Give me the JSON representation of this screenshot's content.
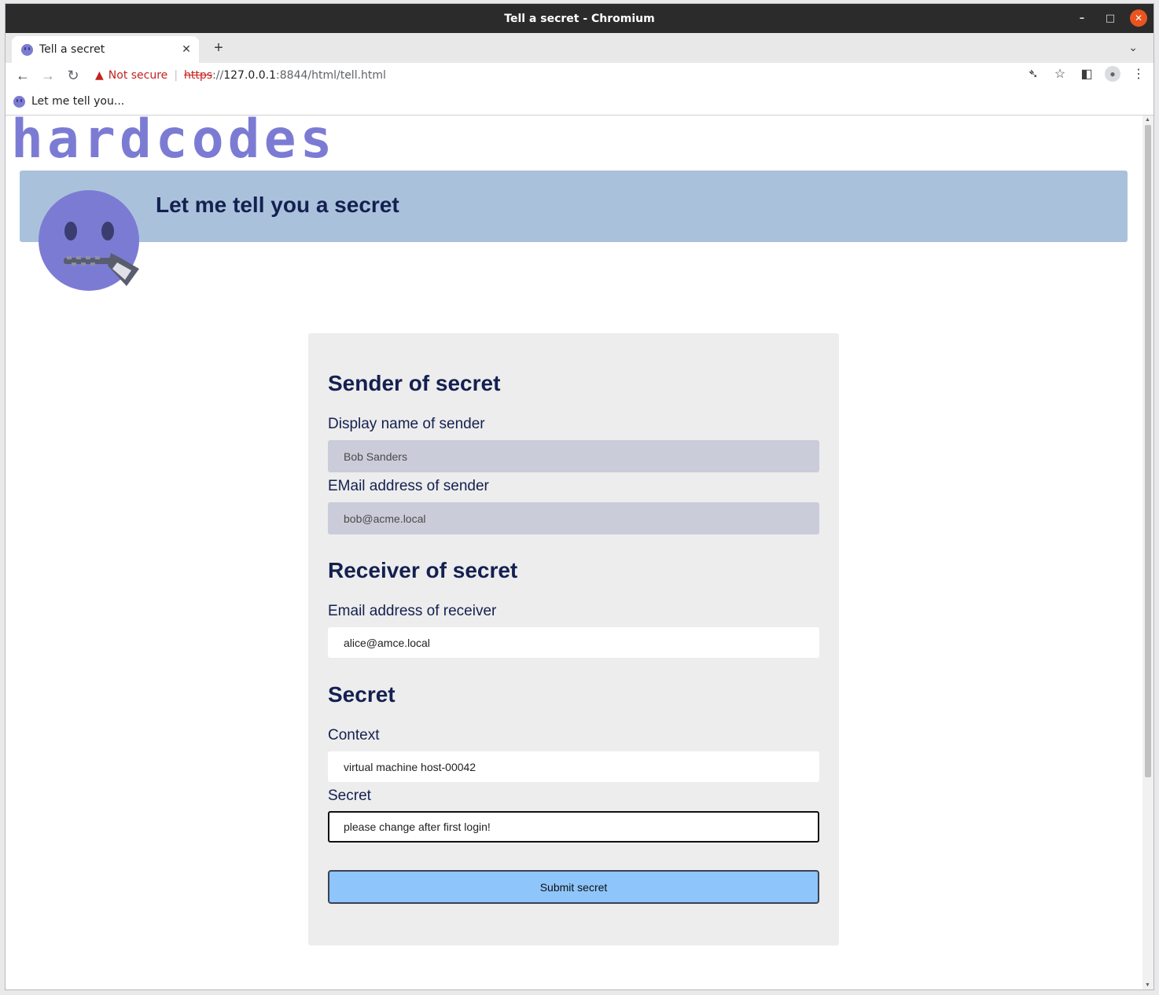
{
  "window": {
    "title": "Tell a secret - Chromium"
  },
  "tab": {
    "title": "Tell a secret"
  },
  "address": {
    "warning": "Not secure",
    "scheme": "https",
    "sep": "://",
    "host": "127.0.0.1",
    "path": ":8844/html/tell.html"
  },
  "bookmarks": [
    {
      "label": "Let me tell you..."
    }
  ],
  "page": {
    "logo": "hardcodes",
    "banner_title": "Let me tell you a secret",
    "sender": {
      "heading": "Sender of secret",
      "name_label": "Display name of sender",
      "name_value": "Bob Sanders",
      "email_label": "EMail address of sender",
      "email_value": "bob@acme.local"
    },
    "receiver": {
      "heading": "Receiver of secret",
      "email_label": "Email address of receiver",
      "email_value": "alice@amce.local"
    },
    "secret": {
      "heading": "Secret",
      "context_label": "Context",
      "context_value": "virtual machine host-00042",
      "secret_label": "Secret",
      "secret_value": "please change after first login!"
    },
    "submit_label": "Submit secret"
  },
  "colors": {
    "accent": "#7c7bd4",
    "banner": "#aac1dc",
    "heading": "#142050",
    "button": "#8ec5fb"
  }
}
